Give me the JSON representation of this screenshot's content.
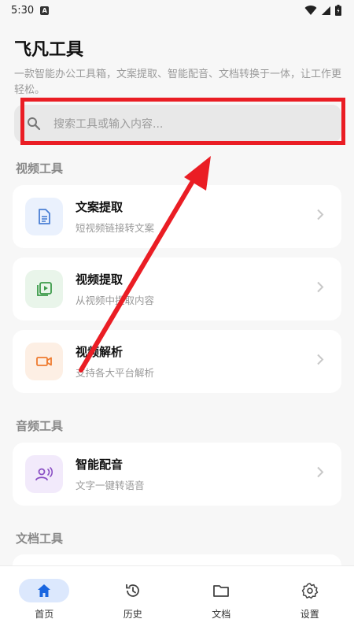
{
  "status_bar": {
    "time": "5:30",
    "notif_label": "A"
  },
  "header": {
    "title": "飞凡工具",
    "description": "一款智能办公工具箱，文案提取、智能配音、文档转换于一体，让工作更轻松。"
  },
  "search": {
    "placeholder": "搜索工具或输入内容..."
  },
  "sections": {
    "video": {
      "label": "视频工具",
      "items": [
        {
          "title": "文案提取",
          "subtitle": "短视频链接转文案",
          "icon": "document-icon",
          "color": "#4a7fd4",
          "bg": "#eaf1fd"
        },
        {
          "title": "视频提取",
          "subtitle": "从视频中提取内容",
          "icon": "video-library-icon",
          "color": "#3c9b4a",
          "bg": "#e9f5ea"
        },
        {
          "title": "视频解析",
          "subtitle": "支持各大平台解析",
          "icon": "video-camera-icon",
          "color": "#ee7b2f",
          "bg": "#fdefe4"
        }
      ]
    },
    "audio": {
      "label": "音频工具",
      "items": [
        {
          "title": "智能配音",
          "subtitle": "文字一键转语音",
          "icon": "voice-icon",
          "color": "#8a4fc4",
          "bg": "#f2eafb"
        }
      ]
    },
    "docs": {
      "label": "文档工具"
    }
  },
  "bottom_nav": [
    {
      "label": "首页",
      "icon": "home-icon",
      "active": true
    },
    {
      "label": "历史",
      "icon": "history-icon",
      "active": false
    },
    {
      "label": "文档",
      "icon": "folder-icon",
      "active": false
    },
    {
      "label": "设置",
      "icon": "gear-icon",
      "active": false
    }
  ],
  "colors": {
    "accent": "#1a66e0",
    "annotation": "#ea1d24",
    "chevron": "#c8c8c8"
  }
}
